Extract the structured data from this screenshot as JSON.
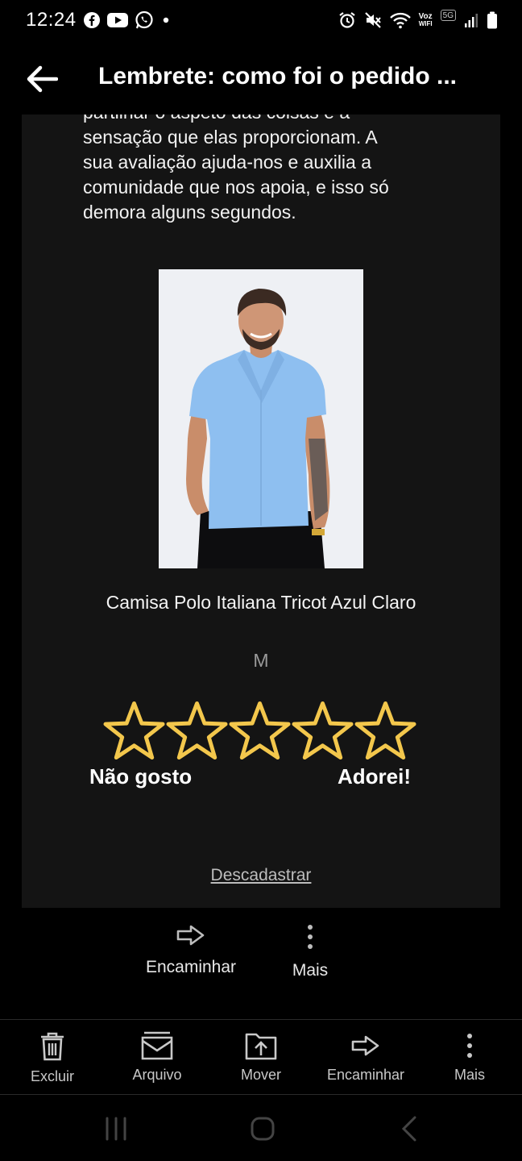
{
  "status_bar": {
    "time": "12:24",
    "left_icons": [
      "facebook-icon",
      "youtube-icon",
      "whatsapp-icon",
      "dot-icon"
    ],
    "right_icons": [
      "alarm-icon",
      "mute-icon",
      "wifi-icon",
      "voz-wifi-icon",
      "5g-icon",
      "signal-icon",
      "battery-icon"
    ],
    "voz_label": "Voz",
    "wifi_label": "WIFI",
    "network_label": "5G"
  },
  "header": {
    "title": "Lembrete: como foi o pedido ..."
  },
  "email": {
    "body_lines": [
      "partilhar o aspeto das coisas e a",
      "sensação que elas proporcionam. A",
      "sua avaliação ajuda-nos e auxilia a",
      "comunidade que nos apoia, e isso só",
      "demora alguns segundos."
    ],
    "product": {
      "name": "Camisa Polo Italiana Tricot Azul Claro",
      "size": "M"
    },
    "rating": {
      "stars": 5,
      "low_label": "Não gosto",
      "high_label": "Adorei!"
    },
    "unsubscribe": "Descadastrar"
  },
  "inline_actions": {
    "forward": "Encaminhar",
    "more": "Mais"
  },
  "toolbar": {
    "delete": "Excluir",
    "archive": "Arquivo",
    "move": "Mover",
    "forward": "Encaminhar",
    "more": "Mais"
  },
  "colors": {
    "background": "#000000",
    "card": "#141414",
    "star": "#f3c74c",
    "shirt": "#8ebff0"
  }
}
